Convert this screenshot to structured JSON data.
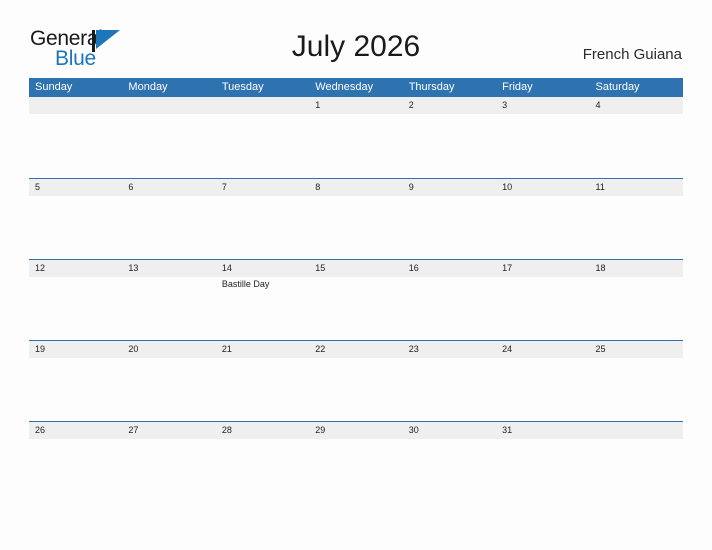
{
  "brand": {
    "name_part1": "General",
    "name_part2": "Blue",
    "flag_icon": "flag-triangle-icon",
    "blue_hex": "#1d76bc"
  },
  "header": {
    "title": "July 2026",
    "region": "French Guiana"
  },
  "colors": {
    "header_blue": "#2e72b0",
    "band_gray": "#efefef",
    "page_background": "#fdfdfd",
    "text_dark": "#222222"
  },
  "calendar": {
    "weekdays": [
      "Sunday",
      "Monday",
      "Tuesday",
      "Wednesday",
      "Thursday",
      "Friday",
      "Saturday"
    ],
    "weeks": [
      {
        "days": [
          {
            "num": "",
            "events": []
          },
          {
            "num": "",
            "events": []
          },
          {
            "num": "",
            "events": []
          },
          {
            "num": "1",
            "events": []
          },
          {
            "num": "2",
            "events": []
          },
          {
            "num": "3",
            "events": []
          },
          {
            "num": "4",
            "events": []
          }
        ]
      },
      {
        "days": [
          {
            "num": "5",
            "events": []
          },
          {
            "num": "6",
            "events": []
          },
          {
            "num": "7",
            "events": []
          },
          {
            "num": "8",
            "events": []
          },
          {
            "num": "9",
            "events": []
          },
          {
            "num": "10",
            "events": []
          },
          {
            "num": "11",
            "events": []
          }
        ]
      },
      {
        "days": [
          {
            "num": "12",
            "events": []
          },
          {
            "num": "13",
            "events": []
          },
          {
            "num": "14",
            "events": [
              "Bastille Day"
            ]
          },
          {
            "num": "15",
            "events": []
          },
          {
            "num": "16",
            "events": []
          },
          {
            "num": "17",
            "events": []
          },
          {
            "num": "18",
            "events": []
          }
        ]
      },
      {
        "days": [
          {
            "num": "19",
            "events": []
          },
          {
            "num": "20",
            "events": []
          },
          {
            "num": "21",
            "events": []
          },
          {
            "num": "22",
            "events": []
          },
          {
            "num": "23",
            "events": []
          },
          {
            "num": "24",
            "events": []
          },
          {
            "num": "25",
            "events": []
          }
        ]
      },
      {
        "days": [
          {
            "num": "26",
            "events": []
          },
          {
            "num": "27",
            "events": []
          },
          {
            "num": "28",
            "events": []
          },
          {
            "num": "29",
            "events": []
          },
          {
            "num": "30",
            "events": []
          },
          {
            "num": "31",
            "events": []
          },
          {
            "num": "",
            "events": []
          }
        ]
      }
    ]
  }
}
